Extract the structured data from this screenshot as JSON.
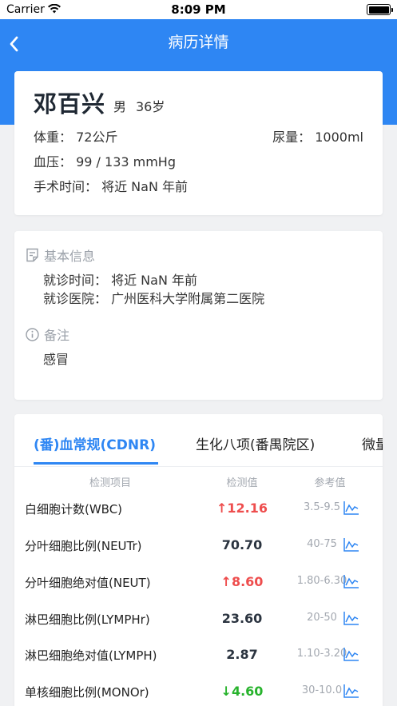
{
  "status_bar": {
    "carrier": "Carrier",
    "time": "8:09 PM"
  },
  "nav": {
    "title": "病历详情"
  },
  "patient": {
    "name": "邓百兴",
    "gender": "男",
    "age": "36岁",
    "weight": "体重： 72公斤",
    "urine": "尿量： 1000ml",
    "blood_pressure": "血压： 99 / 133 mmHg",
    "surgery_time": "手术时间： 将近 NaN 年前"
  },
  "basic_info": {
    "header": "基本信息",
    "visit_time": "就诊时间： 将近 NaN 年前",
    "hospital": "就诊医院： 广州医科大学附属第二医院",
    "remark_header": "备注",
    "remark": "感冒"
  },
  "lab": {
    "tabs": [
      "(番)血常规(CDNR)",
      "生化八项(番禺院区)",
      "微量"
    ],
    "columns": {
      "item": "检测项目",
      "value": "检测值",
      "reference": "参考值"
    },
    "rows": [
      {
        "name": "白细胞计数(WBC)",
        "value": "↑12.16",
        "ref": "3.5-9.5",
        "status": "high"
      },
      {
        "name": "分叶细胞比例(NEUTr)",
        "value": "70.70",
        "ref": "40-75",
        "status": "normal"
      },
      {
        "name": "分叶细胞绝对值(NEUT)",
        "value": "↑8.60",
        "ref": "1.80-6.30",
        "status": "high"
      },
      {
        "name": "淋巴细胞比例(LYMPHr)",
        "value": "23.60",
        "ref": "20-50",
        "status": "normal"
      },
      {
        "name": "淋巴细胞绝对值(LYMPH)",
        "value": "2.87",
        "ref": "1.10-3.20",
        "status": "normal"
      },
      {
        "name": "单核细胞比例(MONOr)",
        "value": "↓4.60",
        "ref": "30-10.0",
        "status": "low"
      }
    ]
  },
  "colors": {
    "primary": "#2e86f3",
    "high": "#ee4d4d",
    "low": "#27b32c"
  },
  "icons": {
    "back": "chevron-left-icon",
    "doc": "document-icon",
    "info": "info-circle-icon",
    "trend": "trend-chart-icon",
    "wifi": "wifi-icon",
    "battery": "battery-icon"
  }
}
